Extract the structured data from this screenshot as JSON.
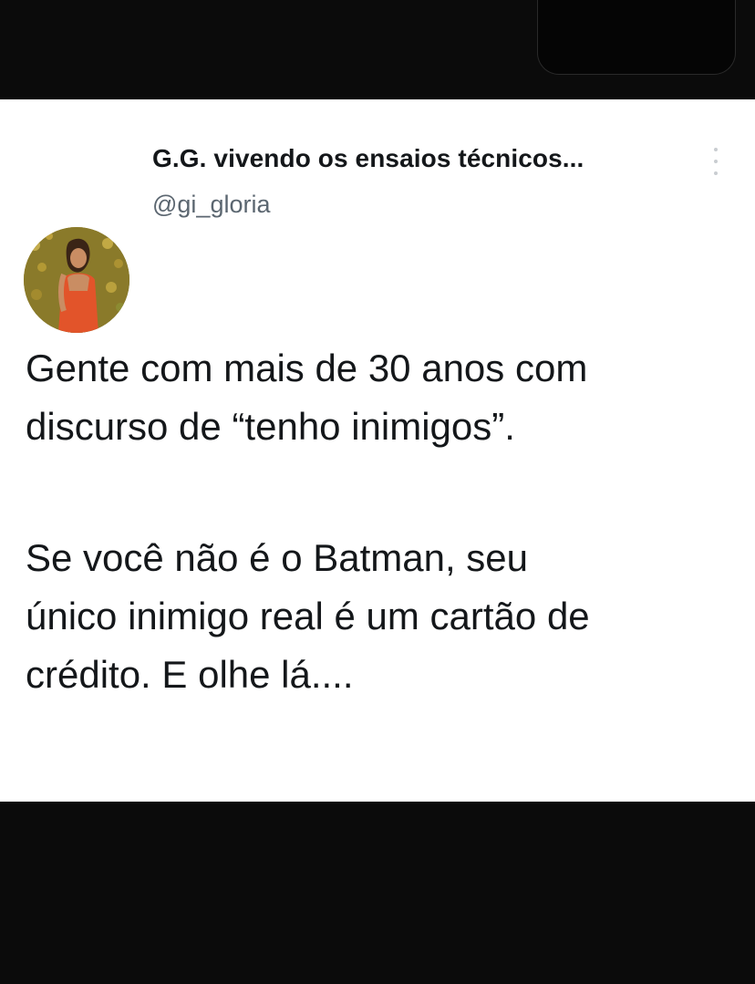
{
  "tweet": {
    "display_name": "G.G. vivendo os ensaios técnicos...",
    "handle": "@gi_gloria",
    "paragraph1": "Gente com mais de 30 anos com\ndiscurso de “tenho inimigos”.",
    "paragraph2": "Se você não é o Batman, seu\núnico inimigo real é um cartão de\ncrédito. E olhe lá...."
  },
  "icons": {
    "more": "more-vertical-icon",
    "avatar": "avatar"
  },
  "colors": {
    "card_background": "#ffffff",
    "frame_background": "#0b0b0b",
    "text_primary": "#14171a",
    "text_secondary": "#5b6670"
  }
}
